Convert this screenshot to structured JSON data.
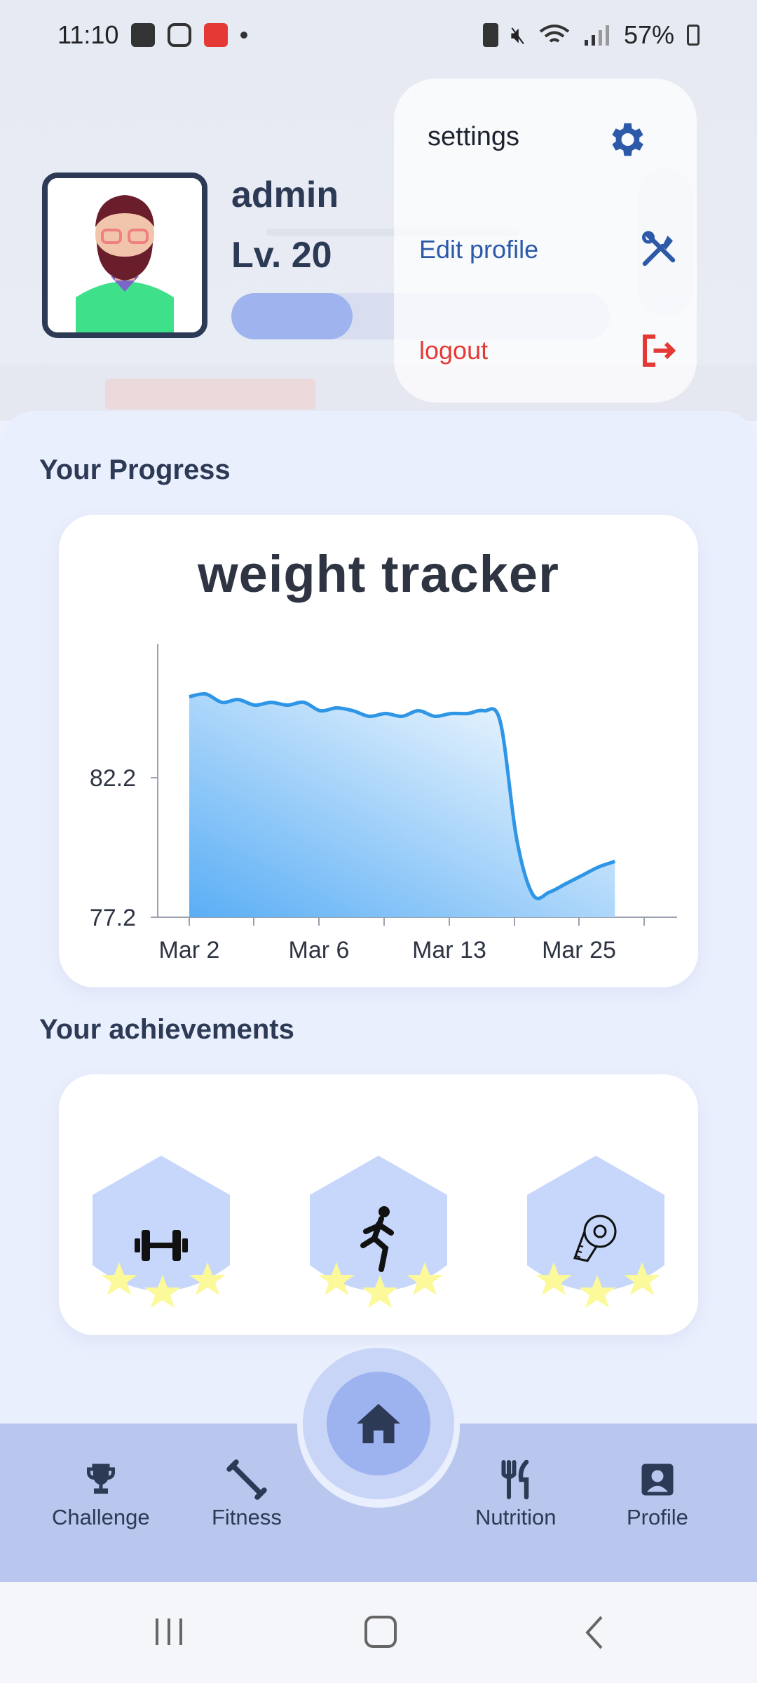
{
  "status_bar": {
    "time": "11:10",
    "battery": "57%"
  },
  "profile": {
    "username": "admin",
    "level": "Lv. 20",
    "xp_progress": 0.32
  },
  "settings_menu": {
    "title": "settings",
    "edit_profile_label": "Edit profile",
    "logout_label": "logout"
  },
  "progress_section": {
    "title": "Your Progress"
  },
  "achievements_section": {
    "title": "Your achievements",
    "badges": [
      {
        "icon": "dumbbell-icon",
        "stars": 3
      },
      {
        "icon": "runner-icon",
        "stars": 3
      },
      {
        "icon": "tape-measure-icon",
        "stars": 3
      }
    ]
  },
  "nav": {
    "challenge": "Challenge",
    "fitness": "Fitness",
    "nutrition": "Nutrition",
    "profile": "Profile"
  },
  "chart_data": {
    "type": "area",
    "title": "weight tracker",
    "x_tick_labels": [
      "Mar 2",
      "Mar 6",
      "Mar 13",
      "Mar 25"
    ],
    "y_tick_labels": [
      "77.2",
      "82.2"
    ],
    "ylim": [
      77.2,
      87.0
    ],
    "x": [
      0,
      0.5,
      1,
      1.5,
      2,
      2.5,
      3,
      3.5,
      4,
      4.5,
      5,
      5.5,
      6,
      6.5,
      7,
      7.5,
      8,
      8.5,
      9,
      9.5,
      10,
      10.5,
      11,
      11.5,
      12,
      12.5,
      13,
      13.5,
      14
    ],
    "y": [
      85.1,
      85.2,
      84.9,
      85.0,
      84.8,
      84.9,
      84.8,
      84.9,
      84.6,
      84.7,
      84.6,
      84.4,
      84.5,
      84.4,
      84.6,
      84.4,
      84.5,
      84.5,
      84.6,
      84.2,
      80.0,
      78.0,
      78.1,
      78.4,
      78.7,
      79.0,
      79.2
    ],
    "colors": {
      "line": "#2f96e6",
      "fill_top": "#ffffff",
      "fill_bottom": "#5aaef5"
    }
  }
}
